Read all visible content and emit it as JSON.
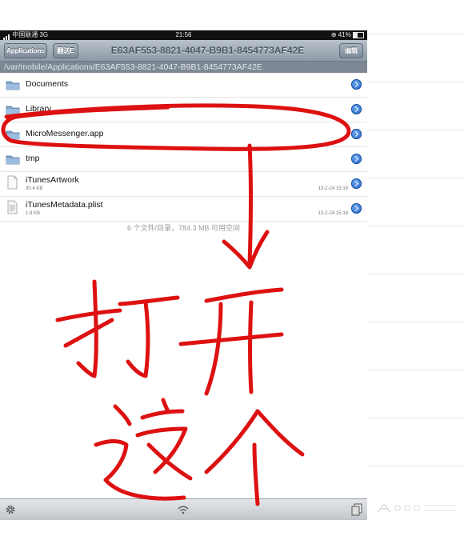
{
  "status_bar": {
    "carrier": "中国联通  3G",
    "time": "21:56",
    "battery": "41%"
  },
  "nav_bar": {
    "back_label": "Applications",
    "copy_label": "翻送E",
    "title": "E63AF553-8821-4047-B9B1-8454773AF42E",
    "edit_label": "编辑"
  },
  "path": "/var/mobile/Applications/E63AF553-8821-4047-B9B1-8454773AF42E",
  "files": [
    {
      "name": "Documents",
      "kind": "folder",
      "icon": "folder-icon"
    },
    {
      "name": "Library",
      "kind": "folder",
      "icon": "folder-icon"
    },
    {
      "name": "MicroMessenger.app",
      "kind": "folder",
      "icon": "folder-icon"
    },
    {
      "name": "tmp",
      "kind": "folder",
      "icon": "folder-icon"
    },
    {
      "name": "iTunesArtwork",
      "kind": "file",
      "icon": "file-icon",
      "size": "30.4 KB",
      "date": "13-2-24 15:18"
    },
    {
      "name": "iTunesMetadata.plist",
      "kind": "file",
      "icon": "document-icon",
      "size": "1.8 KB",
      "date": "13-2-24 15:18"
    }
  ],
  "summary": "6 个文件/目录，784.3 MB 可用空间",
  "annotation_text": "打开这个",
  "colors": {
    "ink": "#dd1111",
    "accent": "#1f63c4",
    "nav": "#8e9aa6"
  }
}
